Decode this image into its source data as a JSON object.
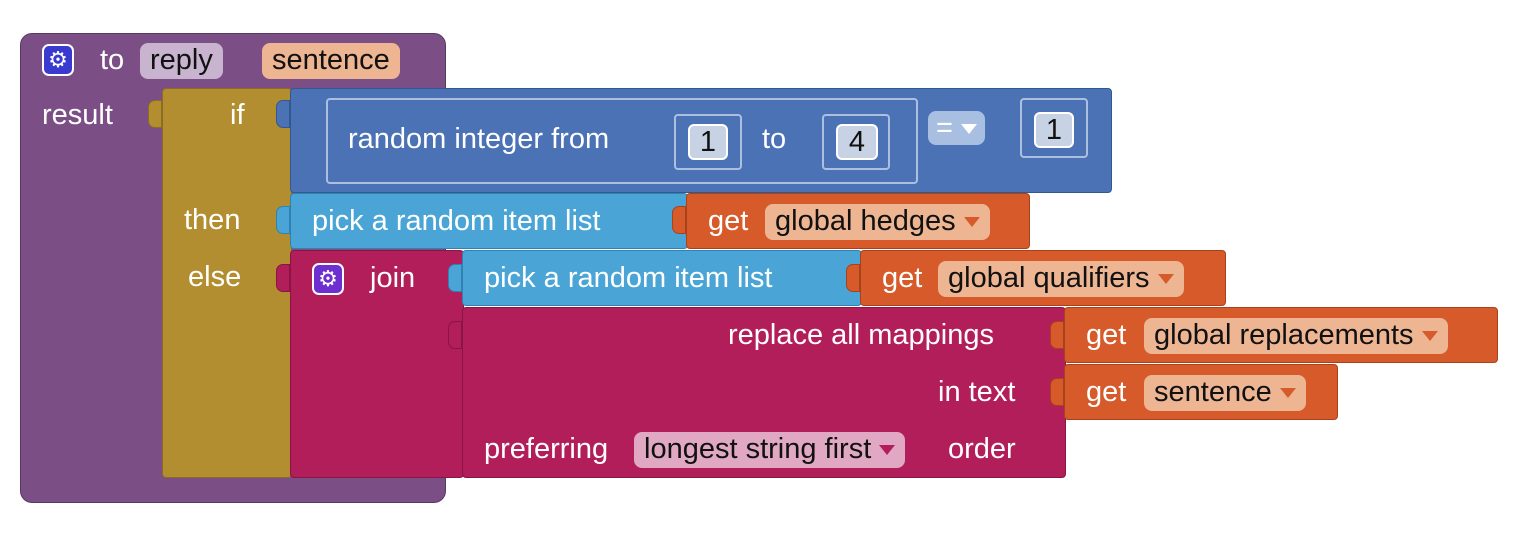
{
  "procedure": {
    "to_label": "to",
    "name": "reply",
    "param": "sentence",
    "result_label": "result",
    "gear_icon": "gear-icon"
  },
  "if_block": {
    "if_label": "if",
    "then_label": "then",
    "else_label": "else"
  },
  "condition": {
    "random_label": "random integer from",
    "from_value": "1",
    "to_label": "to",
    "to_value": "4",
    "operator": "=",
    "compare_value": "1"
  },
  "then_branch": {
    "pick_label": "pick a random item  list",
    "get_label": "get",
    "var": "global hedges"
  },
  "else_branch": {
    "join_label": "join",
    "pick_label": "pick a random item  list",
    "get_label": "get",
    "var": "global qualifiers",
    "replace_label": "replace all mappings",
    "replace_get": "get",
    "replace_var": "global replacements",
    "in_text_label": "in text",
    "text_get": "get",
    "text_var": "sentence",
    "preferring_label": "preferring",
    "preference": "longest string first",
    "order_label": "order"
  },
  "colors": {
    "procedure": "#7b4f86",
    "if": "#b28e31",
    "math": "#4b72b5",
    "list": "#4aa5d6",
    "text": "#b21e5a",
    "variable": "#d65a2a"
  }
}
